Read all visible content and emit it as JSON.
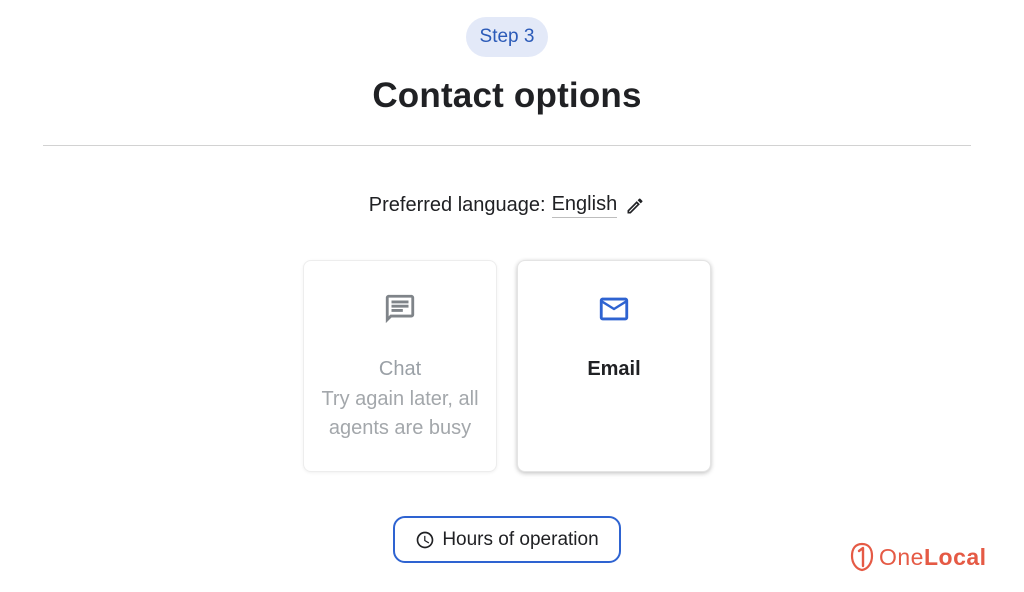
{
  "step": {
    "label": "Step 3"
  },
  "header": {
    "title": "Contact options"
  },
  "language": {
    "label": "Preferred language:",
    "value": "English",
    "edit_icon": "pencil-icon"
  },
  "options": {
    "chat": {
      "icon": "chat-message-icon",
      "label": "Chat",
      "status": "Try again later, all agents are busy",
      "enabled": false
    },
    "email": {
      "icon": "envelope-icon",
      "label": "Email",
      "enabled": true
    }
  },
  "hours_button": {
    "icon": "clock-icon",
    "label": "Hours of operation"
  },
  "watermark": {
    "brand_part1": "One",
    "brand_part2": "Local"
  },
  "colors": {
    "accent_blue": "#2e63d1",
    "pill_background": "#e3e9f8",
    "pill_text": "#2b5ab8",
    "disabled_text": "#9aa0a6",
    "brand_red": "#e55a45"
  }
}
